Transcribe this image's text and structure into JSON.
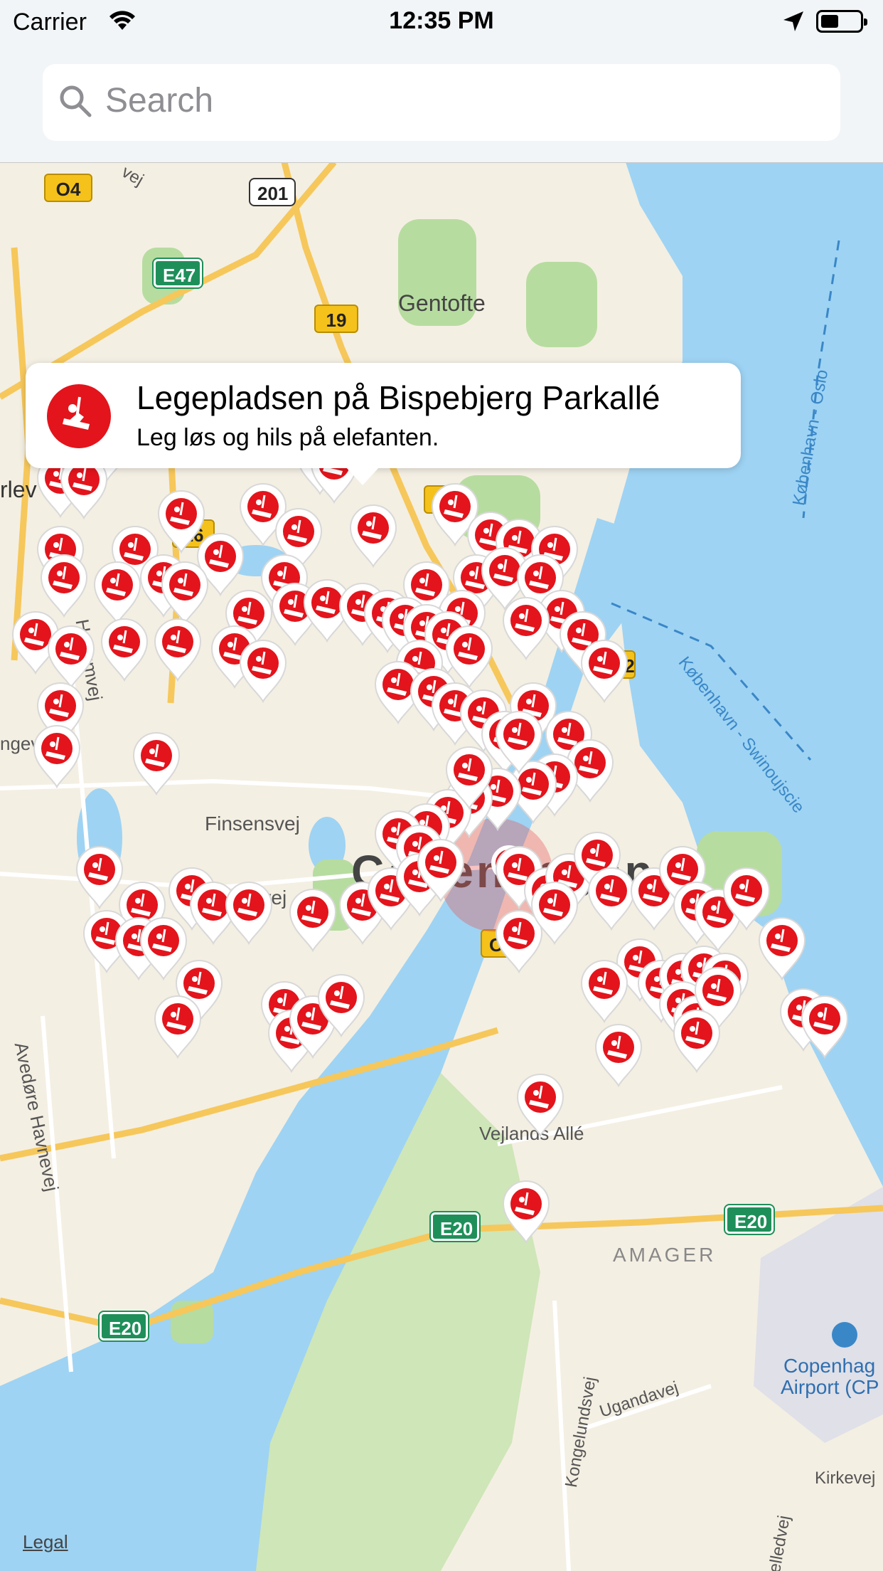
{
  "status": {
    "carrier": "Carrier",
    "time": "12:35 PM"
  },
  "search": {
    "placeholder": "Search"
  },
  "callout": {
    "title": "Legepladsen på Bispebjerg Parkallé",
    "subtitle": "Leg løs og hils på elefanten."
  },
  "map": {
    "city": "Copenhagen",
    "places": {
      "gentofte": "Gentofte",
      "amager": "AMAGER",
      "airport_line1": "Copenhag",
      "airport_line2": "Airport (CP",
      "herlev": "rlev",
      "re": "re"
    },
    "streets": {
      "husumvej": "Husumvej",
      "finsensvej": "Finsensvej",
      "roskildevej": "Roskildevej",
      "vejlands": "Vejlands Allé",
      "avedore": "Avedøre Havnevej",
      "kongelundsvej": "Kongelundsvej",
      "ugandavej": "Ugandavej",
      "kirkevej": "Kirkevej",
      "ingevej": "ngevej",
      "oslo": "København - Oslo",
      "swinoujscie": "København - Swinoujscie",
      "vej_top": "vej",
      "elledvej": "elledvej"
    },
    "shields": {
      "o4": "O4",
      "r201": "201",
      "e47": "E47",
      "r19a": "19",
      "r16": "16",
      "r19b": "19",
      "o2a": "O2",
      "o2b": "O2",
      "e20a": "E20",
      "e20b": "E20",
      "e20c": "E20"
    }
  },
  "legal": "Legal",
  "colors": {
    "pin": "#e3141c",
    "water": "#9ed3f3",
    "park": "#b7dca0",
    "land": "#f4efe3",
    "road": "#f6c75a"
  }
}
